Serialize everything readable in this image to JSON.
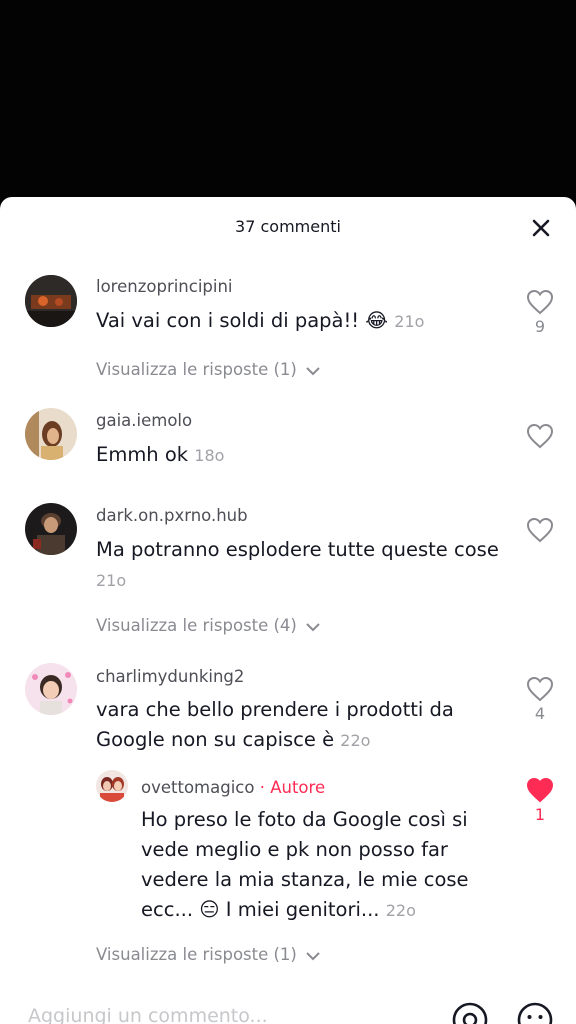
{
  "header": {
    "count_label": "37 commenti"
  },
  "comments": [
    {
      "username": "lorenzoprincipini",
      "text": "Vai vai con i soldi di papà!! 😂",
      "time": "21o",
      "likes": "9",
      "replies_label": "Visualizza le risposte (1)",
      "avatar_color": "#5a3a2a"
    },
    {
      "username": "gaia.iemolo",
      "text": "Emmh ok",
      "time": "18o",
      "likes": "",
      "avatar_color": "#c8a070"
    },
    {
      "username": "dark.on.pxrno.hub",
      "text": "Ma potranno esplodere tutte queste cose",
      "time": "21o",
      "likes": "",
      "replies_label": "Visualizza le risposte (4)",
      "avatar_color": "#3a2e2a"
    },
    {
      "username": "charlimydunking2",
      "text": "vara che bello prendere i prodotti da Google non su capisce è",
      "time": "22o",
      "likes": "4",
      "avatar_color": "#f3d7e6"
    }
  ],
  "reply": {
    "username": "ovettomagico",
    "separator": " · ",
    "author_label": "Autore",
    "text": "Ho preso le foto da Google così si vede meglio e pk non posso far vedere la mia stanza, le mie cose ecc... 😑 I miei genitori...",
    "time": "22o",
    "likes": "1",
    "liked": true,
    "replies_label": "Visualizza le risposte (1)"
  },
  "input": {
    "placeholder": "Aggiungi un commento..."
  },
  "colors": {
    "accent": "#fe2c55",
    "username": "#4e4f56",
    "muted": "#a1a2a7"
  }
}
